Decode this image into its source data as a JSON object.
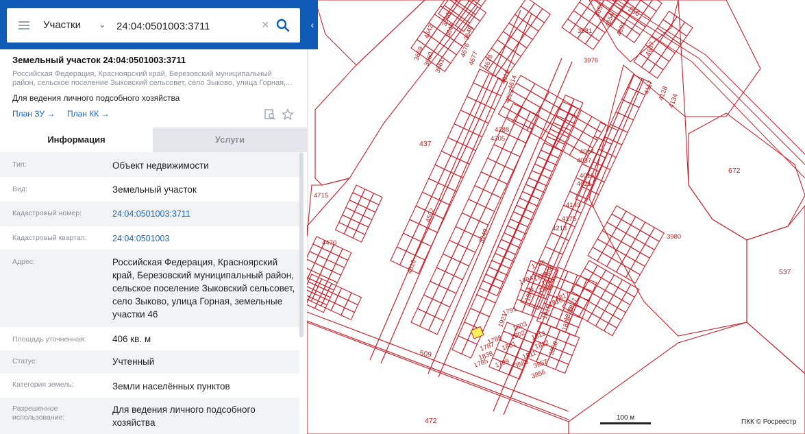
{
  "search": {
    "type_label": "Участки",
    "query": "24:04:0501003:3711"
  },
  "object": {
    "title": "Земельный участок 24:04:0501003:3711",
    "address_short": "Российская Федерация, Красноярский край, Березовский муниципальный район, сельское поселение Зыковский сельсовет, село Зыково, улица Горная,...",
    "use": "Для ведения личного подсобного хозяйства",
    "plan_zu": "План ЗУ →",
    "plan_kk": "План КК →"
  },
  "tabs": {
    "info": "Информация",
    "services": "Услуги"
  },
  "info_rows": [
    {
      "label": "Тип:",
      "value": "Объект недвижимости"
    },
    {
      "label": "Вид:",
      "value": "Земельный участок"
    },
    {
      "label": "Кадастровый номер:",
      "value": "24:04:0501003:3711"
    },
    {
      "label": "Кадастровый квартал:",
      "value": "24:04:0501003"
    },
    {
      "label": "Адрес:",
      "value": "Российская Федерация, Красноярский край, Березовский муниципальный район, сельское поселение Зыковский сельсовет, село Зыково, улица Горная, земельные участки 46"
    },
    {
      "label": "Площадь уточненная:",
      "value": "406 кв. м"
    },
    {
      "label": "Статус:",
      "value": "Учтенный"
    },
    {
      "label": "Категория земель:",
      "value": "Земли населённых пунктов"
    },
    {
      "label": "Разрешенное использование:",
      "value": "Для ведения личного подсобного хозяйства"
    }
  ],
  "map": {
    "parcel_labels": [
      "437",
      "4715",
      "4470",
      "4502",
      "4516",
      "3249",
      "509",
      "472",
      "3976",
      "3981",
      "3980",
      "672",
      "537",
      "4288",
      "4305",
      "4014",
      "4037",
      "4016",
      "4021",
      "4143",
      "4175",
      "4218",
      "3659",
      "3660",
      "3661",
      "4642",
      "3646",
      "3647",
      "3648",
      "4676",
      "4677",
      "4678",
      "4616",
      "4614",
      "4623",
      "4655",
      "4654",
      "4691",
      "4657",
      "4117",
      "4128",
      "4134",
      "256",
      "1796",
      "1808",
      "1795",
      "1807",
      "1794",
      "1806",
      "1817",
      "1827",
      "1816",
      "1826",
      "1805",
      "1815",
      "1825",
      "1791",
      "1921",
      "1803",
      "1802",
      "1813",
      "1788",
      "1801",
      "1812",
      "1787",
      "1811",
      "3858",
      "1838",
      "1799",
      "3586",
      "3857",
      "1785",
      "3856"
    ],
    "scale_label": "100 м",
    "copyright": "ПКК © Росреестр"
  },
  "colors": {
    "header_blue": "#0f5bb5",
    "plot_line": "#c8202a",
    "selected_parcel": "#f7f05a",
    "link": "#1565c0"
  }
}
